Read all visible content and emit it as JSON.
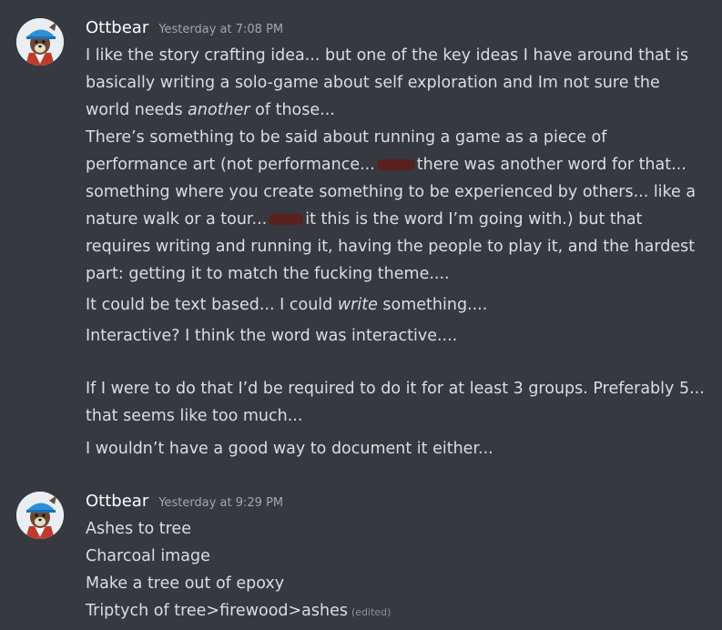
{
  "messages": [
    {
      "author": "Ottbear",
      "timestamp": "Yesterday at 7:08 PM",
      "lines": {
        "l1": "I like the story crafting idea... but one of the key ideas I have around that is",
        "l2": "basically writing a solo-game about self exploration and Im not sure the",
        "l3a": "world needs ",
        "l3b": "another",
        "l3c": " of those...",
        "l4": "There’s something to be said about running a game as a piece of",
        "l5a": "performance art (not performance...",
        "l5b": "there was another word for that...",
        "l6": "something where you create something to be experienced by others... like a",
        "l7a": "nature walk or a tour...",
        "l7b": "it this is the word I’m going with.) but that",
        "l8": "requires writing and running it, having the people to play it, and the hardest",
        "l9": "part: getting it to match the fucking theme....",
        "l10a": "It could be text based... I could ",
        "l10b": "write",
        "l10c": " something....",
        "l11": "Interactive? I think the word was interactive....",
        "l12": "If I were to do that I’d be required to do it for at least 3 groups. Preferably 5...",
        "l13": "that seems like too much...",
        "l14": "I wouldn’t have a good way to document it either..."
      }
    },
    {
      "author": "Ottbear",
      "timestamp": "Yesterday at 9:29 PM",
      "lines": {
        "l1": "Ashes to tree",
        "l2": "Charcoal image",
        "l3": "Make a tree out of epoxy",
        "l4": "Triptych of tree>firewood>ashes"
      },
      "edited_label": "(edited)"
    }
  ],
  "colors": {
    "background": "#36393f",
    "text": "#dcddde",
    "username": "#ffffff",
    "timestamp": "#a3a6aa",
    "redaction": "#5a1f1f"
  },
  "icons": [
    "avatar-fox-with-blue-cap"
  ]
}
